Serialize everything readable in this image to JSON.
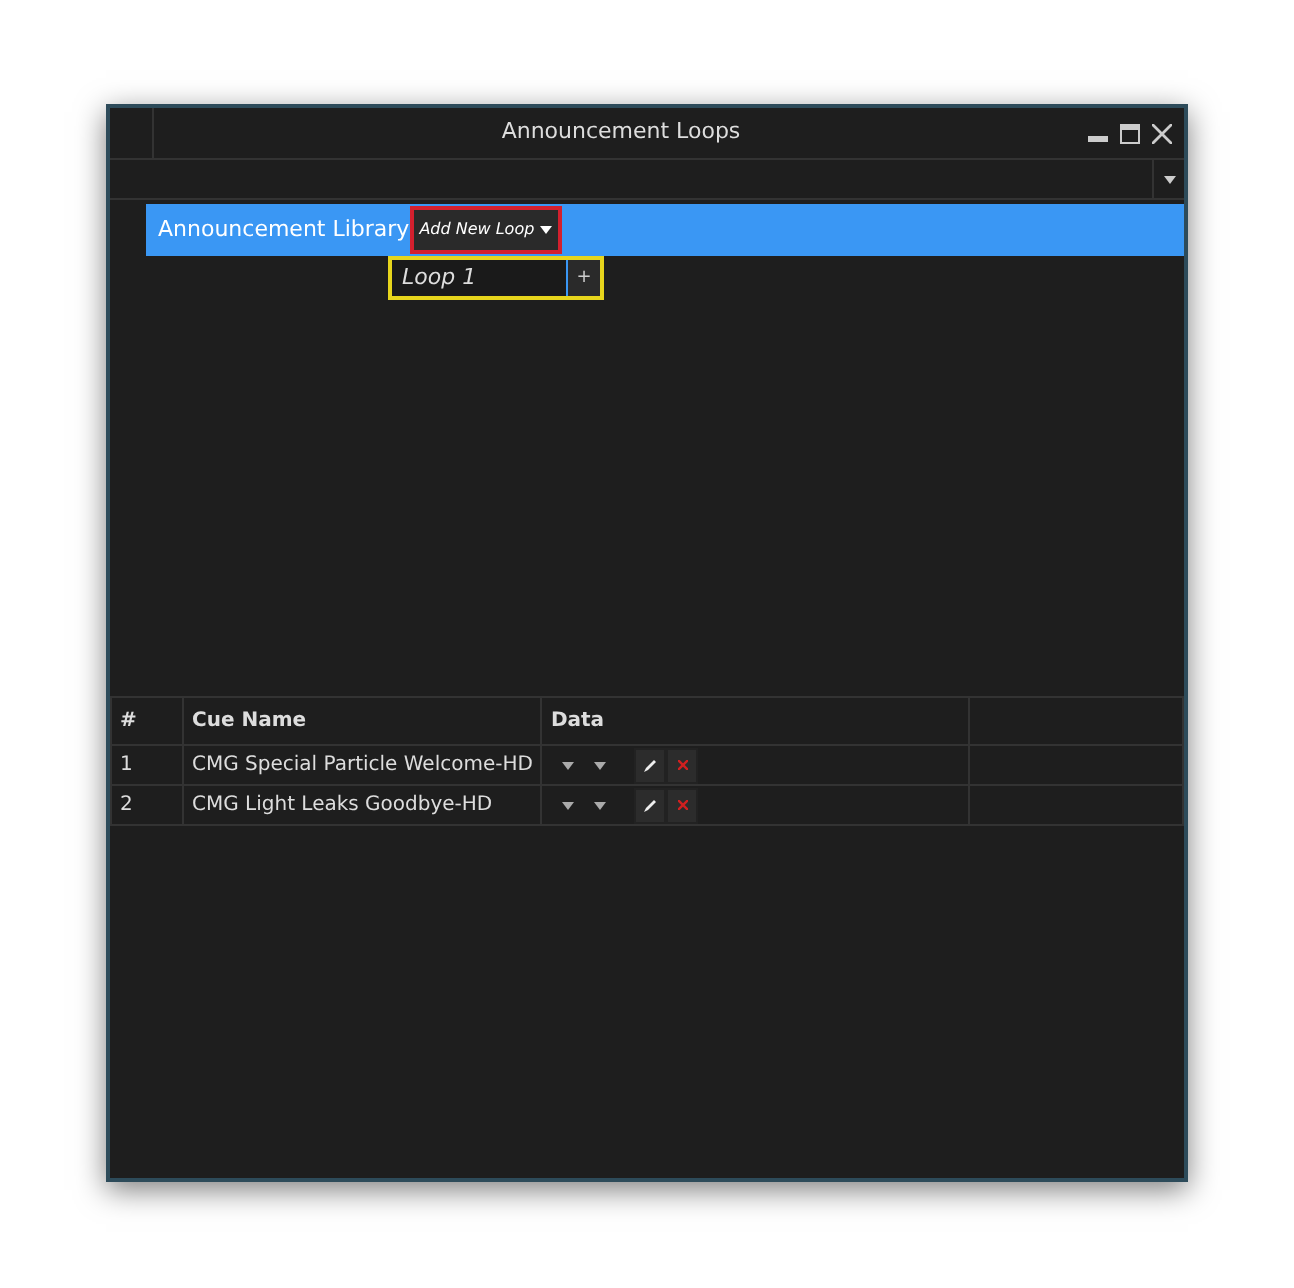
{
  "window": {
    "title": "Announcement Loops"
  },
  "library_bar": {
    "label": "Announcement Library",
    "add_button": "Add New Loop",
    "loop_field": {
      "value": "Loop 1",
      "add_symbol": "+"
    }
  },
  "table": {
    "columns": [
      "#",
      "Cue Name",
      "Data"
    ],
    "rows": [
      {
        "number": "1",
        "cue_name": "CMG Special Particle Welcome-HD"
      },
      {
        "number": "2",
        "cue_name": "CMG Light Leaks Goodbye-HD"
      }
    ]
  }
}
